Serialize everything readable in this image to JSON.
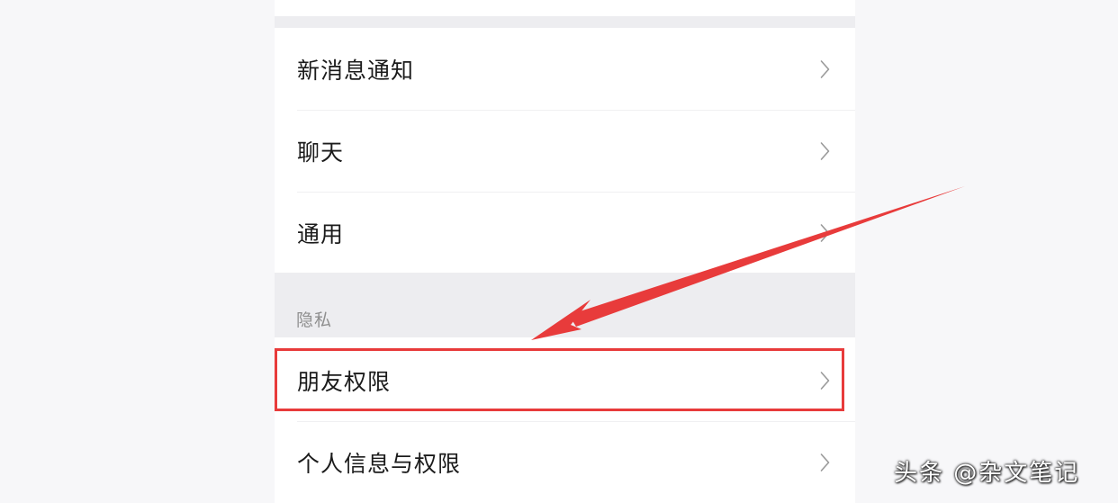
{
  "settings": {
    "items": [
      {
        "label": "新消息通知",
        "icon": "chevron-right-icon"
      },
      {
        "label": "聊天",
        "icon": "chevron-right-icon"
      },
      {
        "label": "通用",
        "icon": "chevron-right-icon"
      }
    ],
    "privacy_section": {
      "header": "隐私",
      "items": [
        {
          "label": "朋友权限",
          "icon": "chevron-right-icon",
          "highlighted": true
        },
        {
          "label": "个人信息与权限",
          "icon": "chevron-right-icon"
        }
      ]
    }
  },
  "annotation": {
    "highlight_color": "#e83b3b",
    "arrow_color": "#e83b3b",
    "target": "朋友权限"
  },
  "watermark": {
    "text": "头条 @杂文笔记"
  }
}
